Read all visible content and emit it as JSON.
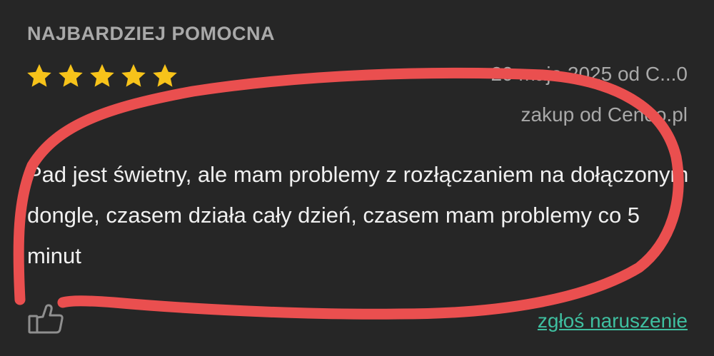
{
  "section": {
    "title": "NAJBARDZIEJ POMOCNA"
  },
  "review": {
    "rating": 5,
    "rating_max": 5,
    "date_author": "20 maja 2025 od C...0",
    "purchase_source": "zakup od Ceneo.pl",
    "text": "Pad jest świetny, ale mam problemy z rozłączaniem na dołączonym dongle, czasem działa cały dzień, czasem mam problemy co 5 minut",
    "helpful_icon": "thumbs-up-icon",
    "report_label": "zgłoś naruszenie"
  },
  "colors": {
    "background": "#262626",
    "star": "#f7c31a",
    "link": "#3fbfa0",
    "annotation": "#ea4f4f"
  }
}
